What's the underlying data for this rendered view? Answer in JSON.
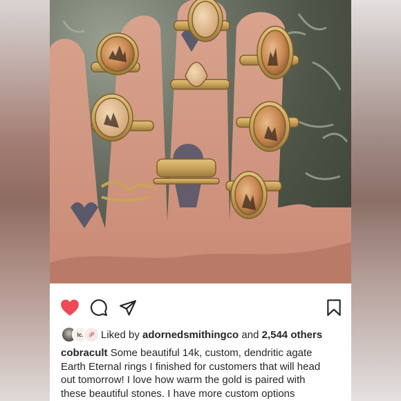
{
  "post": {
    "likes": {
      "prefix": "Liked by",
      "user": "adornedsmithingco",
      "conjunction": "and",
      "others": "2,544 others",
      "avatar_labels": [
        "",
        "lc.",
        "𝒫"
      ]
    },
    "caption": {
      "username": "cobracult",
      "lines": [
        "Some beautiful 14k, custom, dendritic agate",
        "Earth Eternal rings I finished for customers that will head",
        "out tomorrow! I love how warm the gold is paired with",
        "these beautiful stones. I have more custom options"
      ]
    },
    "icons": {
      "like": "heart-icon",
      "comment": "comment-icon",
      "share": "send-icon",
      "save": "bookmark-icon"
    },
    "colors": {
      "like_active": "#ed4956",
      "text": "#262626",
      "gold": "#c9a35a"
    }
  }
}
